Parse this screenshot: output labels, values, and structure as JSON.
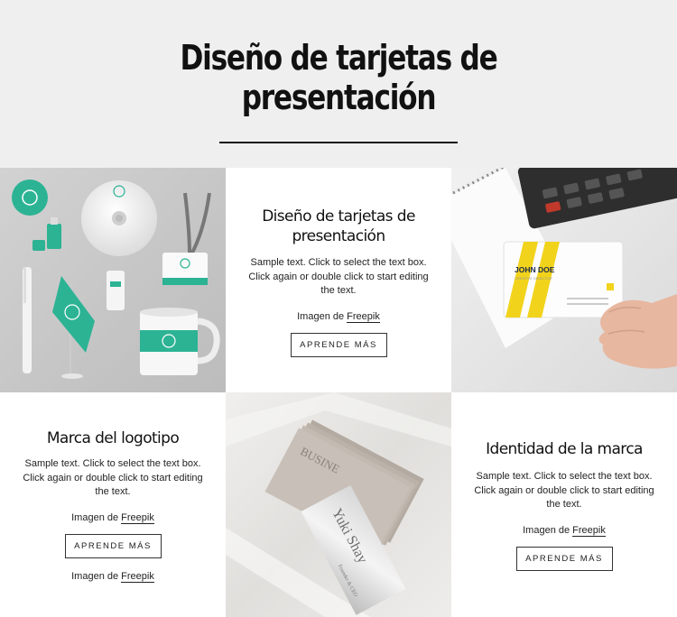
{
  "hero": {
    "title": "Diseño de tarjetas de\npresentación"
  },
  "cards": {
    "c1": {
      "title": "Diseño de tarjetas de\npresentación",
      "body": "Sample text. Click to select the text box. Click again or double click to start editing the text.",
      "credit_prefix": "Imagen de ",
      "credit_link": "Freepik",
      "button": "APRENDE MÁS"
    },
    "c2": {
      "title": "Marca del logotipo",
      "body": "Sample text. Click to select the text box. Click again or double click to start editing the text.",
      "credit_prefix": "Imagen de ",
      "credit_link": "Freepik",
      "button": "APRENDE MÁS",
      "credit2_prefix": "Imagen de ",
      "credit2_link": "Freepik"
    },
    "c3": {
      "title": "Identidad de la marca",
      "body": "Sample text. Click to select the text box. Click again or double click to start editing the text.",
      "credit_prefix": "Imagen de ",
      "credit_link": "Freepik",
      "button": "APRENDE MÁS"
    }
  },
  "images": {
    "business_card": {
      "name": "JOHN DOE",
      "role": "CREATIVE DIRECTOR"
    },
    "stack_card": {
      "text": "BUSINE",
      "name": "Yuki Shay",
      "role": "Founder & CEO"
    }
  },
  "colors": {
    "hero_bg": "#efefef",
    "brand_green": "#2cb394",
    "card_yellow": "#f2d31c"
  }
}
